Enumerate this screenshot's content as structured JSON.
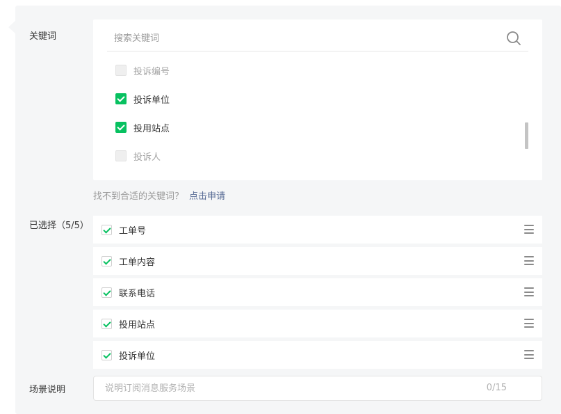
{
  "labels": {
    "keyword": "关键词",
    "selected": "已选择（5/5）",
    "scene": "场景说明"
  },
  "search": {
    "placeholder": "搜索关键词",
    "icon": "search-icon"
  },
  "options": [
    {
      "label": "投诉编号",
      "state": "disabled"
    },
    {
      "label": "投诉单位",
      "state": "checked"
    },
    {
      "label": "投用站点",
      "state": "checked"
    },
    {
      "label": "投诉人",
      "state": "disabled"
    }
  ],
  "hint": {
    "text": "找不到合适的关键词？",
    "link": "点击申请"
  },
  "selected_items": [
    {
      "label": "工单号"
    },
    {
      "label": "工单内容"
    },
    {
      "label": "联系电话"
    },
    {
      "label": "投用站点"
    },
    {
      "label": "投诉单位"
    }
  ],
  "scene": {
    "placeholder": "说明订阅消息服务场景",
    "counter": "0/15"
  },
  "colors": {
    "accent": "#07c160",
    "link": "#576b95",
    "panel_bg": "#f5f6f7"
  }
}
